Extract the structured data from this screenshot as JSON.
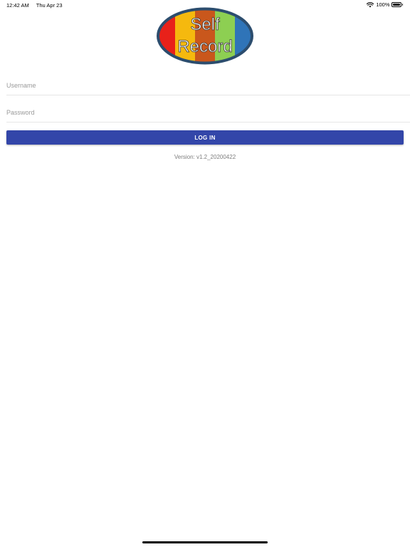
{
  "status_bar": {
    "time": "12:42 AM",
    "date": "Thu Apr 23",
    "battery_percent": "100%",
    "battery_level": 1.0,
    "icons": [
      "wifi-icon",
      "battery-icon"
    ]
  },
  "logo": {
    "line1": "Self",
    "line2": "Record",
    "colors": [
      "#e8211a",
      "#f5b90e",
      "#c9571c",
      "#8dcf52",
      "#2f74b8"
    ],
    "border_color": "#2c4d6e"
  },
  "login": {
    "username_placeholder": "Username",
    "username_value": "",
    "password_placeholder": "Password",
    "password_value": "",
    "button_label": "LOG IN",
    "button_color": "#3346a9"
  },
  "footer": {
    "version": "Version: v1.2_20200422"
  }
}
